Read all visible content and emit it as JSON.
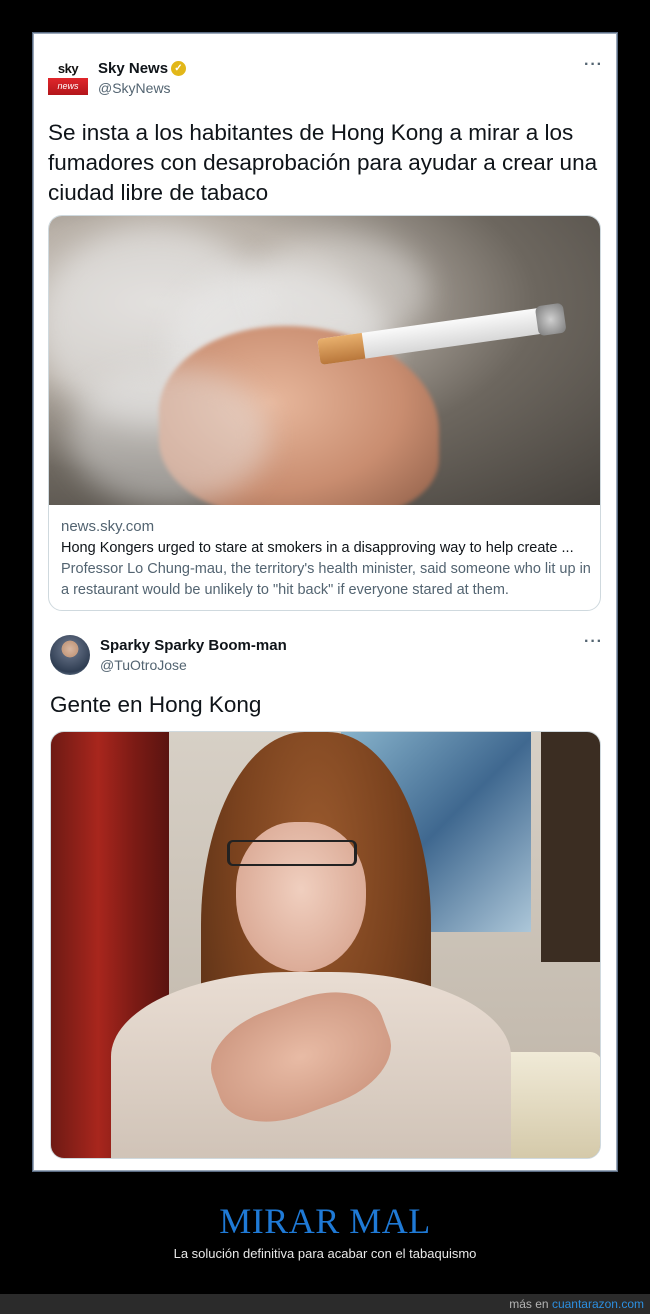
{
  "tweet1": {
    "avatar_top": "sky",
    "avatar_bottom": "news",
    "name": "Sky News",
    "handle": "@SkyNews",
    "verified_icon": "verified-badge-icon",
    "more": "···",
    "text": "Se insta a los habitantes de Hong Kong a mirar a los fumadores con desaprobación para ayudar a crear una ciudad libre de tabaco",
    "card": {
      "domain": "news.sky.com",
      "title": "Hong Kongers urged to stare at smokers in a disapproving way to help create ...",
      "description": "Professor Lo Chung-mau, the territory's health minister, said someone who lit up in a restaurant would be unlikely to \"hit back\" if everyone stared at them."
    }
  },
  "tweet2": {
    "name": "Sparky Sparky Boom-man",
    "handle": "@TuOtroJose",
    "more": "···",
    "text": "Gente en Hong Kong"
  },
  "caption": {
    "title": "MIRAR MAL",
    "subtitle": "La solución definitiva para acabar con el tabaquismo"
  },
  "footer": {
    "prefix": "más en",
    "link": "cuantarazon.com"
  },
  "colors": {
    "caption_title": "#1f7ad6",
    "footer_link": "#2c8fe0",
    "background": "#000000"
  }
}
